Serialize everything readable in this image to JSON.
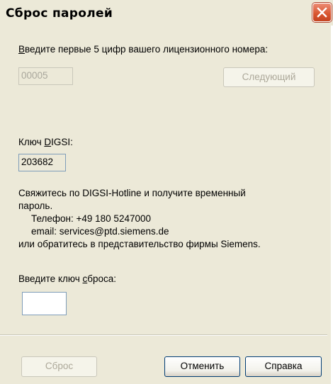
{
  "window": {
    "title": "Сброс паролей"
  },
  "license": {
    "prompt_underlined": "В",
    "prompt_rest": "ведите первые 5 цифр вашего лицензионного номера:",
    "value": "00005",
    "next_label": "Следующий"
  },
  "digsi": {
    "label_pre": "Ключ ",
    "label_underlined": "D",
    "label_post": "IGSI:",
    "value": "203682"
  },
  "contact": {
    "line1": "Свяжитесь по DIGSI-Hotline и получите временный",
    "line2": "пароль.",
    "phone": "Телефон: +49 180 5247000",
    "email": "email: services@ptd.siemens.de",
    "line5": "или обратитесь в представительство фирмы Siemens."
  },
  "reset_key": {
    "label_pre": "Введите ключ ",
    "label_underlined": "с",
    "label_post": "броса:",
    "value": ""
  },
  "buttons": {
    "reset": "Сброс",
    "cancel": "Отменить",
    "help": "Справка"
  },
  "icons": {
    "close": "close-icon"
  }
}
